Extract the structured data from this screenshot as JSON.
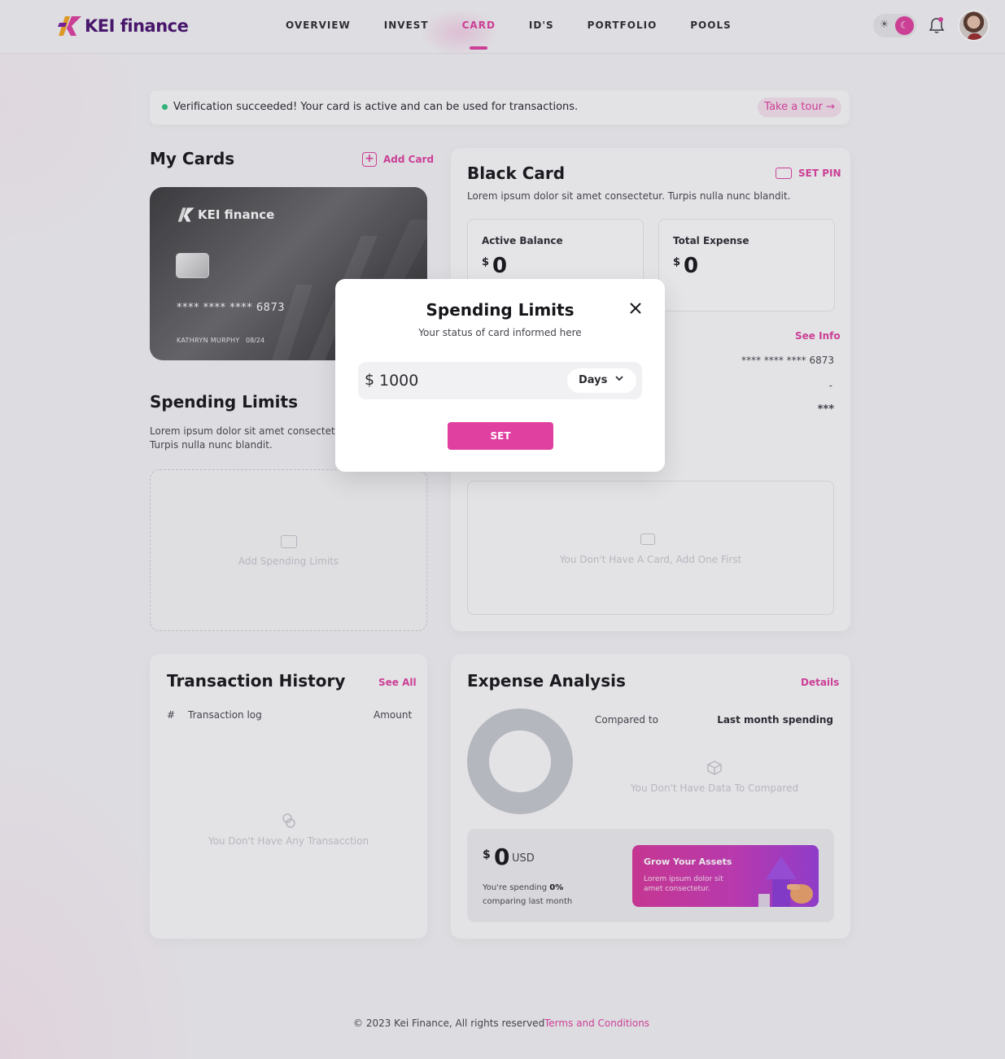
{
  "header": {
    "logo_text": "KEI finance",
    "nav": [
      "OVERVIEW",
      "INVEST",
      "CARD",
      "ID'S",
      "PORTFOLIO",
      "POOLS"
    ],
    "active_nav": "CARD"
  },
  "banner": {
    "message": "Verification succeeded! Your card is active and can be used for transactions.",
    "tour_label": "Take a tour →"
  },
  "my_cards": {
    "title": "My Cards",
    "add_label": "Add Card",
    "card": {
      "brand": "KEI finance",
      "number": "**** **** **** 6873",
      "holder": "KATHRYN MURPHY",
      "expiry": "08/24"
    }
  },
  "spending_limits": {
    "title": "Spending Limits",
    "description": "Lorem ipsum dolor sit amet consectetur. Turpis nulla nunc blandit.",
    "empty_label": "Add Spending Limits"
  },
  "black_card": {
    "title": "Black Card",
    "set_pin_label": "SET PIN",
    "description": "Lorem ipsum dolor sit amet consectetur. Turpis nulla nunc blandit.",
    "active_balance_label": "Active Balance",
    "active_balance_currency": "$",
    "active_balance_value": "0",
    "total_expense_label": "Total Expense",
    "total_expense_currency": "$",
    "total_expense_value": "0",
    "see_info_label": "See Info",
    "number": "**** **** **** 6873",
    "dash": "-",
    "cvv": "***",
    "empty_label": "You Don't Have A Card, Add One First"
  },
  "transactions": {
    "title": "Transaction History",
    "see_all_label": "See All",
    "columns": [
      "#",
      "Transaction log",
      "Amount"
    ],
    "empty_label": "You Don't Have Any Transacction"
  },
  "expense": {
    "title": "Expense Analysis",
    "details_label": "Details",
    "compared_label": "Compared to",
    "compared_value": "Last month spending",
    "empty_label": "You Don't Have Data To Compared",
    "amount_currency": "$",
    "amount_value": "0",
    "amount_unit": "USD",
    "spending_prefix": "You're spending",
    "spending_pct": "0%",
    "spending_suffix": "comparing last month",
    "promo_title": "Grow Your Assets",
    "promo_desc": "Lorem ipsum dolor sit amet consectetur."
  },
  "footer": {
    "copyright": "© 2023 Kei Finance, All rights reserved",
    "terms_label": "Terms and Conditions"
  },
  "modal": {
    "title": "Spending Limits",
    "subtitle": "Your status of card informed here",
    "currency": "$",
    "amount_value": "1000",
    "period": "Days",
    "submit_label": "SET"
  },
  "colors": {
    "accent": "#e040a0",
    "brand": "#4b1270",
    "success": "#2ec27e"
  }
}
